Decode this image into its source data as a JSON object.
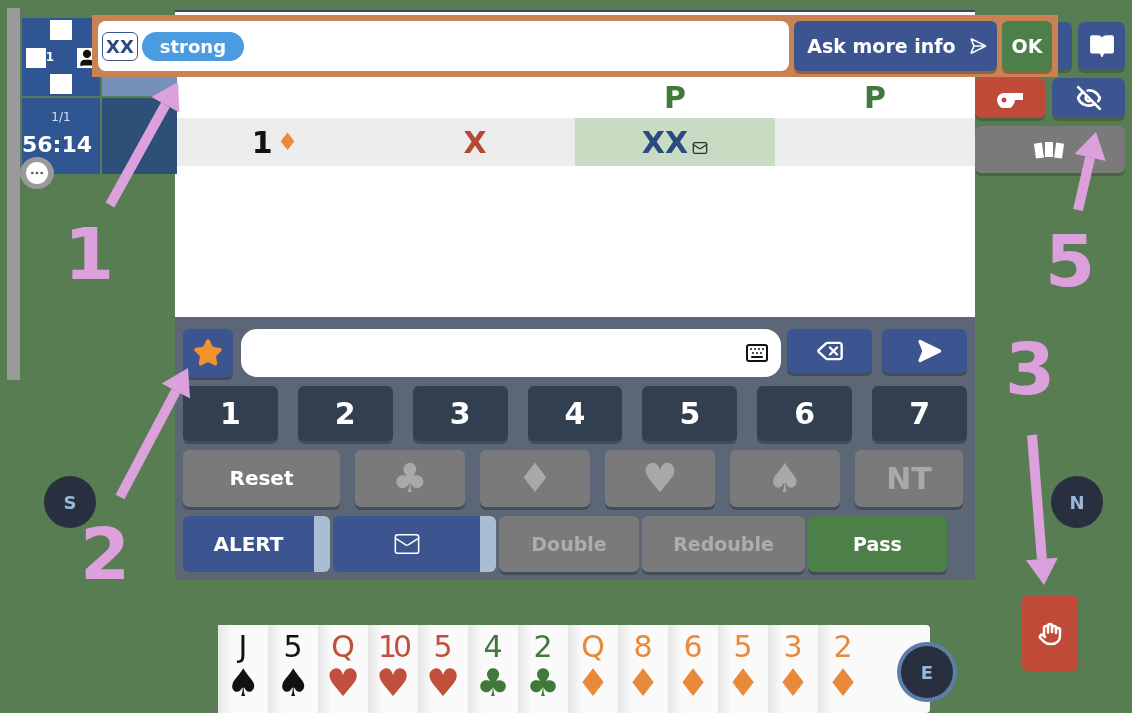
{
  "scoreboard": {
    "board_number": "1",
    "progress": "1/1",
    "timer": "56:14"
  },
  "explanation_bar": {
    "bid": "XX",
    "tag": "strong",
    "ask_button": "Ask more info",
    "ok_button": "OK"
  },
  "bidding_table": {
    "rows": [
      {
        "cells": [
          {
            "kind": "empty",
            "highlighted": false
          },
          {
            "kind": "empty",
            "highlighted": false
          },
          {
            "kind": "pass",
            "text": "P",
            "highlighted": false
          },
          {
            "kind": "pass",
            "text": "P",
            "highlighted": false
          }
        ]
      },
      {
        "cells": [
          {
            "kind": "bid",
            "text": "1",
            "suit": "♦",
            "color": "#e98a3a",
            "highlighted": false
          },
          {
            "kind": "double",
            "text": "X",
            "highlighted": false
          },
          {
            "kind": "redouble",
            "text": "XX",
            "alerted": true,
            "highlighted": true
          },
          {
            "kind": "empty",
            "highlighted": false
          }
        ]
      }
    ]
  },
  "keypad": {
    "levels": [
      "1",
      "2",
      "3",
      "4",
      "5",
      "6",
      "7"
    ],
    "strains": [
      {
        "kind": "reset",
        "label": "Reset",
        "disabled": false
      },
      {
        "kind": "suit",
        "label": "♣",
        "disabled": true
      },
      {
        "kind": "suit",
        "label": "♦",
        "disabled": true
      },
      {
        "kind": "suit",
        "label": "♥",
        "disabled": true
      },
      {
        "kind": "suit",
        "label": "♠",
        "disabled": true
      },
      {
        "kind": "notrump",
        "label": "NT",
        "disabled": true
      }
    ],
    "actions": [
      {
        "kind": "alert",
        "label": "ALERT",
        "disabled": false
      },
      {
        "kind": "message",
        "disabled": false
      },
      {
        "kind": "double",
        "label": "Double",
        "disabled": true
      },
      {
        "kind": "redouble",
        "label": "Redouble",
        "disabled": true
      },
      {
        "kind": "pass",
        "label": "Pass",
        "disabled": false
      }
    ]
  },
  "seats": [
    {
      "kind": "south",
      "label": "S"
    },
    {
      "kind": "north",
      "label": "N"
    },
    {
      "kind": "east",
      "label": "E"
    }
  ],
  "hand": [
    {
      "rank": "J",
      "suit": "♠",
      "color": "#111111"
    },
    {
      "rank": "5",
      "suit": "♠",
      "color": "#111111"
    },
    {
      "rank": "Q",
      "suit": "♥",
      "color": "#c0503c"
    },
    {
      "rank": "10",
      "suit": "♥",
      "color": "#c0503c"
    },
    {
      "rank": "5",
      "suit": "♥",
      "color": "#c0503c"
    },
    {
      "rank": "4",
      "suit": "♣",
      "color": "#3f7a3c"
    },
    {
      "rank": "2",
      "suit": "♣",
      "color": "#3f7a3c"
    },
    {
      "rank": "Q",
      "suit": "♦",
      "color": "#e98a3a"
    },
    {
      "rank": "8",
      "suit": "♦",
      "color": "#e98a3a"
    },
    {
      "rank": "6",
      "suit": "♦",
      "color": "#e98a3a"
    },
    {
      "rank": "5",
      "suit": "♦",
      "color": "#e98a3a"
    },
    {
      "rank": "3",
      "suit": "♦",
      "color": "#e98a3a"
    },
    {
      "rank": "2",
      "suit": "♦",
      "color": "#e98a3a"
    }
  ],
  "annotations": [
    {
      "kind": "one",
      "label": "1"
    },
    {
      "kind": "five",
      "label": "5"
    },
    {
      "kind": "three",
      "label": "3"
    },
    {
      "kind": "two",
      "label": "2"
    }
  ]
}
